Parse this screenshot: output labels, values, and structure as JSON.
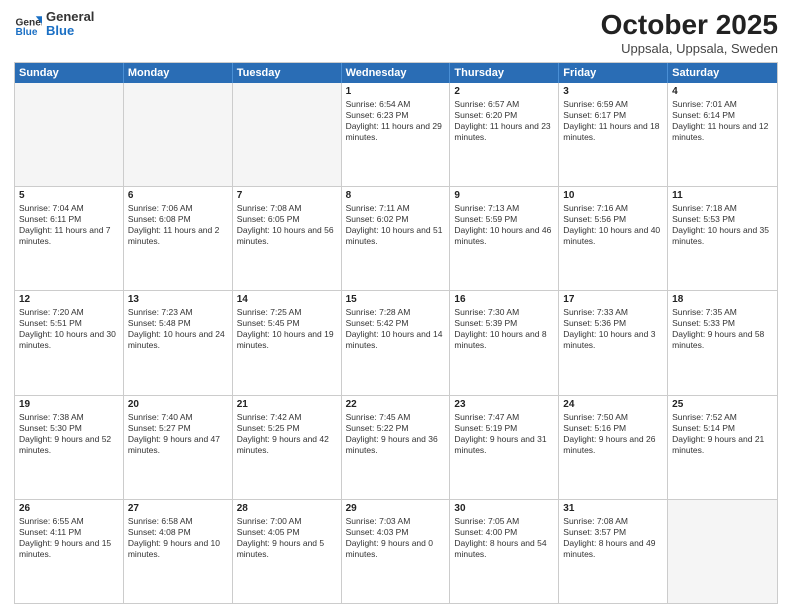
{
  "header": {
    "logo_general": "General",
    "logo_blue": "Blue",
    "month_title": "October 2025",
    "location": "Uppsala, Uppsala, Sweden"
  },
  "weekdays": [
    "Sunday",
    "Monday",
    "Tuesday",
    "Wednesday",
    "Thursday",
    "Friday",
    "Saturday"
  ],
  "rows": [
    [
      {
        "day": "",
        "empty": true
      },
      {
        "day": "",
        "empty": true
      },
      {
        "day": "",
        "empty": true
      },
      {
        "day": "1",
        "sunrise": "Sunrise: 6:54 AM",
        "sunset": "Sunset: 6:23 PM",
        "daylight": "Daylight: 11 hours and 29 minutes."
      },
      {
        "day": "2",
        "sunrise": "Sunrise: 6:57 AM",
        "sunset": "Sunset: 6:20 PM",
        "daylight": "Daylight: 11 hours and 23 minutes."
      },
      {
        "day": "3",
        "sunrise": "Sunrise: 6:59 AM",
        "sunset": "Sunset: 6:17 PM",
        "daylight": "Daylight: 11 hours and 18 minutes."
      },
      {
        "day": "4",
        "sunrise": "Sunrise: 7:01 AM",
        "sunset": "Sunset: 6:14 PM",
        "daylight": "Daylight: 11 hours and 12 minutes."
      }
    ],
    [
      {
        "day": "5",
        "sunrise": "Sunrise: 7:04 AM",
        "sunset": "Sunset: 6:11 PM",
        "daylight": "Daylight: 11 hours and 7 minutes."
      },
      {
        "day": "6",
        "sunrise": "Sunrise: 7:06 AM",
        "sunset": "Sunset: 6:08 PM",
        "daylight": "Daylight: 11 hours and 2 minutes."
      },
      {
        "day": "7",
        "sunrise": "Sunrise: 7:08 AM",
        "sunset": "Sunset: 6:05 PM",
        "daylight": "Daylight: 10 hours and 56 minutes."
      },
      {
        "day": "8",
        "sunrise": "Sunrise: 7:11 AM",
        "sunset": "Sunset: 6:02 PM",
        "daylight": "Daylight: 10 hours and 51 minutes."
      },
      {
        "day": "9",
        "sunrise": "Sunrise: 7:13 AM",
        "sunset": "Sunset: 5:59 PM",
        "daylight": "Daylight: 10 hours and 46 minutes."
      },
      {
        "day": "10",
        "sunrise": "Sunrise: 7:16 AM",
        "sunset": "Sunset: 5:56 PM",
        "daylight": "Daylight: 10 hours and 40 minutes."
      },
      {
        "day": "11",
        "sunrise": "Sunrise: 7:18 AM",
        "sunset": "Sunset: 5:53 PM",
        "daylight": "Daylight: 10 hours and 35 minutes."
      }
    ],
    [
      {
        "day": "12",
        "sunrise": "Sunrise: 7:20 AM",
        "sunset": "Sunset: 5:51 PM",
        "daylight": "Daylight: 10 hours and 30 minutes."
      },
      {
        "day": "13",
        "sunrise": "Sunrise: 7:23 AM",
        "sunset": "Sunset: 5:48 PM",
        "daylight": "Daylight: 10 hours and 24 minutes."
      },
      {
        "day": "14",
        "sunrise": "Sunrise: 7:25 AM",
        "sunset": "Sunset: 5:45 PM",
        "daylight": "Daylight: 10 hours and 19 minutes."
      },
      {
        "day": "15",
        "sunrise": "Sunrise: 7:28 AM",
        "sunset": "Sunset: 5:42 PM",
        "daylight": "Daylight: 10 hours and 14 minutes."
      },
      {
        "day": "16",
        "sunrise": "Sunrise: 7:30 AM",
        "sunset": "Sunset: 5:39 PM",
        "daylight": "Daylight: 10 hours and 8 minutes."
      },
      {
        "day": "17",
        "sunrise": "Sunrise: 7:33 AM",
        "sunset": "Sunset: 5:36 PM",
        "daylight": "Daylight: 10 hours and 3 minutes."
      },
      {
        "day": "18",
        "sunrise": "Sunrise: 7:35 AM",
        "sunset": "Sunset: 5:33 PM",
        "daylight": "Daylight: 9 hours and 58 minutes."
      }
    ],
    [
      {
        "day": "19",
        "sunrise": "Sunrise: 7:38 AM",
        "sunset": "Sunset: 5:30 PM",
        "daylight": "Daylight: 9 hours and 52 minutes."
      },
      {
        "day": "20",
        "sunrise": "Sunrise: 7:40 AM",
        "sunset": "Sunset: 5:27 PM",
        "daylight": "Daylight: 9 hours and 47 minutes."
      },
      {
        "day": "21",
        "sunrise": "Sunrise: 7:42 AM",
        "sunset": "Sunset: 5:25 PM",
        "daylight": "Daylight: 9 hours and 42 minutes."
      },
      {
        "day": "22",
        "sunrise": "Sunrise: 7:45 AM",
        "sunset": "Sunset: 5:22 PM",
        "daylight": "Daylight: 9 hours and 36 minutes."
      },
      {
        "day": "23",
        "sunrise": "Sunrise: 7:47 AM",
        "sunset": "Sunset: 5:19 PM",
        "daylight": "Daylight: 9 hours and 31 minutes."
      },
      {
        "day": "24",
        "sunrise": "Sunrise: 7:50 AM",
        "sunset": "Sunset: 5:16 PM",
        "daylight": "Daylight: 9 hours and 26 minutes."
      },
      {
        "day": "25",
        "sunrise": "Sunrise: 7:52 AM",
        "sunset": "Sunset: 5:14 PM",
        "daylight": "Daylight: 9 hours and 21 minutes."
      }
    ],
    [
      {
        "day": "26",
        "sunrise": "Sunrise: 6:55 AM",
        "sunset": "Sunset: 4:11 PM",
        "daylight": "Daylight: 9 hours and 15 minutes."
      },
      {
        "day": "27",
        "sunrise": "Sunrise: 6:58 AM",
        "sunset": "Sunset: 4:08 PM",
        "daylight": "Daylight: 9 hours and 10 minutes."
      },
      {
        "day": "28",
        "sunrise": "Sunrise: 7:00 AM",
        "sunset": "Sunset: 4:05 PM",
        "daylight": "Daylight: 9 hours and 5 minutes."
      },
      {
        "day": "29",
        "sunrise": "Sunrise: 7:03 AM",
        "sunset": "Sunset: 4:03 PM",
        "daylight": "Daylight: 9 hours and 0 minutes."
      },
      {
        "day": "30",
        "sunrise": "Sunrise: 7:05 AM",
        "sunset": "Sunset: 4:00 PM",
        "daylight": "Daylight: 8 hours and 54 minutes."
      },
      {
        "day": "31",
        "sunrise": "Sunrise: 7:08 AM",
        "sunset": "Sunset: 3:57 PM",
        "daylight": "Daylight: 8 hours and 49 minutes."
      },
      {
        "day": "",
        "empty": true
      }
    ]
  ]
}
